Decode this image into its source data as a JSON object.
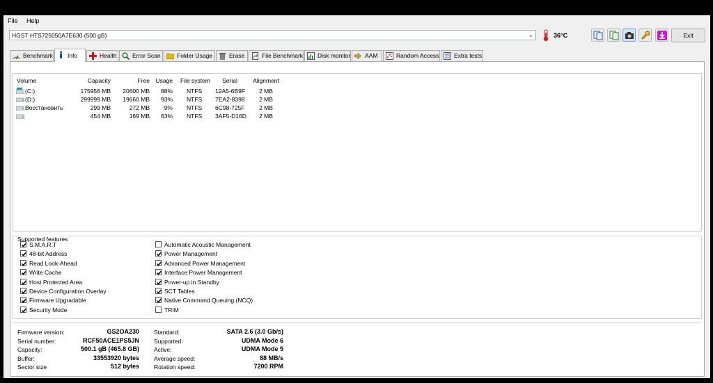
{
  "menu": {
    "file": "File",
    "help": "Help"
  },
  "drive": {
    "selected": "HGST HTS725050A7E630 (500 gB)"
  },
  "temperature": "36°C",
  "toolbar": {
    "buttons": [
      "copy-text-icon",
      "copy-all-icon",
      "screenshot-icon",
      "options-icon",
      "save-icon"
    ],
    "exit_label": "Exit"
  },
  "tabs": [
    {
      "label": "Benchmark",
      "icon": "benchmark-icon"
    },
    {
      "label": "Info",
      "icon": "info-icon"
    },
    {
      "label": "Health",
      "icon": "health-icon"
    },
    {
      "label": "Error Scan",
      "icon": "error-scan-icon"
    },
    {
      "label": "Folder Usage",
      "icon": "folder-icon"
    },
    {
      "label": "Erase",
      "icon": "erase-icon"
    },
    {
      "label": "File Benchmark",
      "icon": "file-benchmark-icon"
    },
    {
      "label": "Disk monitor",
      "icon": "disk-monitor-icon"
    },
    {
      "label": "AAM",
      "icon": "speaker-icon"
    },
    {
      "label": "Random Access",
      "icon": "random-access-icon"
    },
    {
      "label": "Extra tests",
      "icon": "extra-tests-icon"
    }
  ],
  "active_tab": "Info",
  "volumes": {
    "headers": [
      "Volume",
      "Capacity",
      "Free",
      "Usage",
      "File system",
      "Serial",
      "Alignment"
    ],
    "rows": [
      {
        "volume": "(C:)",
        "capacity": "175956 MB",
        "free": "20600 MB",
        "usage": "88%",
        "fs": "NTFS",
        "serial": "12A5-6B9F",
        "alignment": "2 MB"
      },
      {
        "volume": "(D:)",
        "capacity": "299999 MB",
        "free": "19660 MB",
        "usage": "93%",
        "fs": "NTFS",
        "serial": "7EA2-8398",
        "alignment": "2 MB"
      },
      {
        "volume": "Восстановить",
        "capacity": "299 MB",
        "free": "272 MB",
        "usage": "9%",
        "fs": "NTFS",
        "serial": "6C98-725F",
        "alignment": "2 MB"
      },
      {
        "volume": "",
        "capacity": "454 MB",
        "free": "169 MB",
        "usage": "63%",
        "fs": "NTFS",
        "serial": "3AF5-D16D",
        "alignment": "2 MB"
      }
    ]
  },
  "features": {
    "title": "Supported features",
    "left": [
      {
        "label": "S.M.A.R.T",
        "checked": true
      },
      {
        "label": "48-bit Address",
        "checked": true
      },
      {
        "label": "Read Look-Ahead",
        "checked": true
      },
      {
        "label": "Write Cache",
        "checked": true
      },
      {
        "label": "Host Protected Area",
        "checked": true
      },
      {
        "label": "Device Configuration Overlay",
        "checked": true
      },
      {
        "label": "Firmware Upgradable",
        "checked": true
      },
      {
        "label": "Security Mode",
        "checked": true
      }
    ],
    "right": [
      {
        "label": "Automatic Acoustic Management",
        "checked": false
      },
      {
        "label": "Power Management",
        "checked": true
      },
      {
        "label": "Advanced Power Management",
        "checked": true
      },
      {
        "label": "Interface Power Management",
        "checked": true
      },
      {
        "label": "Power-up in Standby",
        "checked": true
      },
      {
        "label": "SCT Tables",
        "checked": true
      },
      {
        "label": "Native Command Queuing (NCQ)",
        "checked": true
      },
      {
        "label": "TRIM",
        "checked": false
      }
    ]
  },
  "info": {
    "left": [
      {
        "label": "Firmware version:",
        "value": "GS2OA230"
      },
      {
        "label": "Serial number:",
        "value": "RCF50ACE1PS5JN"
      },
      {
        "label": "Capacity:",
        "value": "500.1 gB (465.8 GB)"
      },
      {
        "label": "Buffer:",
        "value": "33553920 bytes"
      },
      {
        "label": "Sector size",
        "value": "512 bytes"
      }
    ],
    "right": [
      {
        "label": "Standard:",
        "value": "SATA 2.6 (3.0 Gb/s)"
      },
      {
        "label": "Supported:",
        "value": "UDMA Mode 6"
      },
      {
        "label": "Active:",
        "value": "UDMA Mode 5"
      },
      {
        "label": "Average speed:",
        "value": "88 MB/s"
      },
      {
        "label": "Rotation speed:",
        "value": "7200 RPM"
      }
    ]
  }
}
